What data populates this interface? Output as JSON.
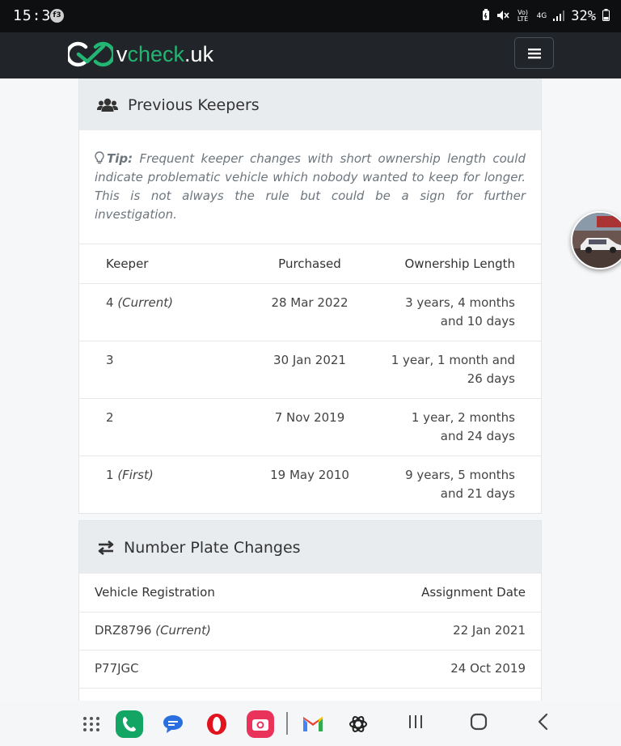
{
  "status_bar": {
    "time": "15:36",
    "notification_badge": "f3",
    "network_lte": "Vo) LTE",
    "network_4g": "4G",
    "battery_percent": "32%"
  },
  "navbar": {
    "brand_prefix": "v",
    "brand_green": "check",
    "brand_suffix": ".uk",
    "brand_color": "#22b573"
  },
  "previous_keepers": {
    "title": "Previous Keepers",
    "tip_label": "Tip:",
    "tip_text": "Frequent keeper changes with short ownership length could indicate problematic vehicle which nobody wanted to keep for longer. This is not always the rule but could be a sign for further investigation.",
    "columns": [
      "Keeper",
      "Purchased",
      "Ownership Length"
    ],
    "rows": [
      {
        "keeper": "4",
        "note": "(Current)",
        "purchased": "28 Mar 2022",
        "length_line1": "3 years, 4 months",
        "length_line2": "and 10 days"
      },
      {
        "keeper": "3",
        "note": "",
        "purchased": "30 Jan 2021",
        "length_line1": "1 year, 1 month and",
        "length_line2": "26 days"
      },
      {
        "keeper": "2",
        "note": "",
        "purchased": "7 Nov 2019",
        "length_line1": "1 year, 2 months",
        "length_line2": "and 24 days"
      },
      {
        "keeper": "1",
        "note": "(First)",
        "purchased": "19 May 2010",
        "length_line1": "9 years, 5 months",
        "length_line2": "and 21 days"
      }
    ]
  },
  "number_plate_changes": {
    "title": "Number Plate Changes",
    "columns": [
      "Vehicle Registration",
      "Assignment Date"
    ],
    "rows": [
      {
        "registration": "DRZ8796",
        "note": "(Current)",
        "date": "22 Jan 2021"
      },
      {
        "registration": "P77JGC",
        "note": "",
        "date": "24 Oct 2019"
      }
    ]
  },
  "icons": {
    "keepers_header": "users-icon",
    "plates_header": "exchange-arrows-icon",
    "tip": "lightbulb-icon",
    "menu": "hamburger-menu-icon"
  },
  "bottom_nav": {
    "apps": [
      "app-drawer",
      "phone",
      "messages",
      "opera",
      "camera",
      "gmail",
      "chatgpt"
    ],
    "buttons": [
      "recents",
      "home",
      "back"
    ]
  }
}
